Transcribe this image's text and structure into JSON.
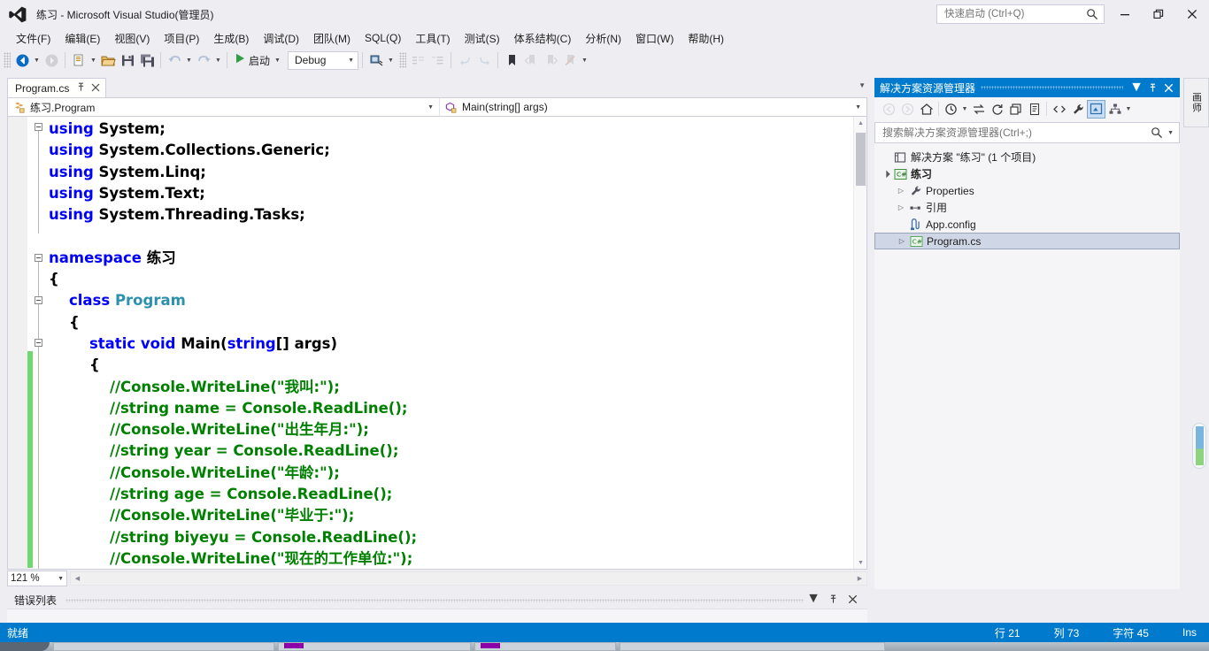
{
  "titlebar": {
    "app_title": "练习 - Microsoft Visual Studio(管理员)",
    "logo_icon": "visual-studio-logo-icon",
    "quick_launch_placeholder": "快速启动 (Ctrl+Q)",
    "quick_launch_value": "",
    "search_icon": "search-icon",
    "minimize_icon": "minimize-icon",
    "restore_icon": "restore-icon",
    "close_icon": "close-icon"
  },
  "menubar": {
    "items": [
      {
        "label": "文件(F)"
      },
      {
        "label": "编辑(E)"
      },
      {
        "label": "视图(V)"
      },
      {
        "label": "项目(P)"
      },
      {
        "label": "生成(B)"
      },
      {
        "label": "调试(D)"
      },
      {
        "label": "团队(M)"
      },
      {
        "label": "SQL(Q)"
      },
      {
        "label": "工具(T)"
      },
      {
        "label": "测试(S)"
      },
      {
        "label": "体系结构(C)"
      },
      {
        "label": "分析(N)"
      },
      {
        "label": "窗口(W)"
      },
      {
        "label": "帮助(H)"
      }
    ]
  },
  "toolbar": {
    "navigate_back_icon": "navigate-back-icon",
    "navigate_forward_icon": "navigate-forward-icon",
    "new_project_icon": "new-project-icon",
    "open_file_icon": "open-file-icon",
    "save_icon": "save-icon",
    "save_all_icon": "save-all-icon",
    "undo_icon": "undo-icon",
    "redo_icon": "redo-icon",
    "start_icon": "start-debug-play-icon",
    "start_label": "启动",
    "config_value": "Debug",
    "config_caret_icon": "chevron-down-icon",
    "attach_process_icon": "attach-to-process-icon",
    "comment_icon": "comment-selection-icon",
    "uncomment_icon": "uncomment-selection-icon",
    "undo_nav_icon": "undo-last-nav-icon",
    "redo_nav_icon": "redo-last-nav-icon",
    "bookmark_icon": "bookmark-icon",
    "prev_bookmark_icon": "previous-bookmark-icon",
    "next_bookmark_icon": "next-bookmark-icon",
    "clear_bookmark_icon": "clear-bookmark-icon",
    "overflow_icon": "toolbar-overflow-icon"
  },
  "editor": {
    "tab_label": "Program.cs",
    "tab_pin_icon": "pin-icon",
    "tab_close_icon": "close-icon",
    "nav_left_icon": "class-member-icon",
    "nav_left_value": "练习.Program",
    "nav_right_icon": "method-icon",
    "nav_right_value": "Main(string[] args)",
    "caret_icon": "chevron-down-icon",
    "zoom_level": "121 %",
    "code_lines": [
      {
        "indent": 0,
        "segments": [
          {
            "t": "using",
            "c": "k"
          },
          {
            "t": " System;",
            "c": ""
          }
        ]
      },
      {
        "indent": 0,
        "segments": [
          {
            "t": "using",
            "c": "k"
          },
          {
            "t": " System.Collections.Generic;",
            "c": ""
          }
        ]
      },
      {
        "indent": 0,
        "segments": [
          {
            "t": "using",
            "c": "k"
          },
          {
            "t": " System.Linq;",
            "c": ""
          }
        ]
      },
      {
        "indent": 0,
        "segments": [
          {
            "t": "using",
            "c": "k"
          },
          {
            "t": " System.Text;",
            "c": ""
          }
        ]
      },
      {
        "indent": 0,
        "segments": [
          {
            "t": "using",
            "c": "k"
          },
          {
            "t": " System.Threading.Tasks;",
            "c": ""
          }
        ]
      },
      {
        "indent": 0,
        "segments": [
          {
            "t": "",
            "c": ""
          }
        ]
      },
      {
        "indent": 0,
        "segments": [
          {
            "t": "namespace",
            "c": "k"
          },
          {
            "t": " 练习",
            "c": ""
          }
        ]
      },
      {
        "indent": 0,
        "segments": [
          {
            "t": "{",
            "c": ""
          }
        ]
      },
      {
        "indent": 1,
        "segments": [
          {
            "t": "class ",
            "c": "k"
          },
          {
            "t": "Program",
            "c": "ty"
          }
        ]
      },
      {
        "indent": 1,
        "segments": [
          {
            "t": "{",
            "c": ""
          }
        ]
      },
      {
        "indent": 2,
        "segments": [
          {
            "t": "static void ",
            "c": "k"
          },
          {
            "t": "Main(",
            "c": ""
          },
          {
            "t": "string",
            "c": "k"
          },
          {
            "t": "[] args)",
            "c": ""
          }
        ]
      },
      {
        "indent": 2,
        "segments": [
          {
            "t": "{",
            "c": ""
          }
        ]
      },
      {
        "indent": 3,
        "segments": [
          {
            "t": "//Console.WriteLine(\"我叫:\");",
            "c": "cm"
          }
        ]
      },
      {
        "indent": 3,
        "segments": [
          {
            "t": "//string name = Console.ReadLine();",
            "c": "cm"
          }
        ]
      },
      {
        "indent": 3,
        "segments": [
          {
            "t": "//Console.WriteLine(\"出生年月:\");",
            "c": "cm"
          }
        ]
      },
      {
        "indent": 3,
        "segments": [
          {
            "t": "//string year = Console.ReadLine();",
            "c": "cm"
          }
        ]
      },
      {
        "indent": 3,
        "segments": [
          {
            "t": "//Console.WriteLine(\"年龄:\");",
            "c": "cm"
          }
        ]
      },
      {
        "indent": 3,
        "segments": [
          {
            "t": "//string age = Console.ReadLine();",
            "c": "cm"
          }
        ]
      },
      {
        "indent": 3,
        "segments": [
          {
            "t": "//Console.WriteLine(\"毕业于:\");",
            "c": "cm"
          }
        ]
      },
      {
        "indent": 3,
        "segments": [
          {
            "t": "//string biyeyu = Console.ReadLine();",
            "c": "cm"
          }
        ]
      },
      {
        "indent": 3,
        "segments": [
          {
            "t": "//Console.WriteLine(\"现在的工作单位:\");",
            "c": "cm"
          }
        ]
      }
    ]
  },
  "error_panel": {
    "title": "错误列表",
    "dropdown_icon": "chevron-down-icon",
    "pin_icon": "pin-icon",
    "close_icon": "close-icon"
  },
  "solution_explorer": {
    "title": "解决方案资源管理器",
    "dropdown_icon": "chevron-down-icon",
    "pin_icon": "pin-icon",
    "close_icon": "close-icon",
    "toolbar": {
      "back_icon": "navigate-back-icon",
      "forward_icon": "navigate-forward-icon",
      "home_icon": "home-icon",
      "pending_changes_icon": "pending-changes-filter-icon",
      "sync_icon": "sync-with-active-document-icon",
      "refresh_icon": "refresh-icon",
      "collapse_all_icon": "collapse-all-icon",
      "show_all_files_icon": "show-all-files-icon",
      "code_view_icon": "view-code-icon",
      "properties_icon": "properties-wrench-icon",
      "preview_icon": "preview-selected-items-icon",
      "class_view_icon": "class-view-icon",
      "overflow_icon": "chevron-down-icon"
    },
    "search_placeholder": "搜索解决方案资源管理器(Ctrl+;)",
    "search_value": "",
    "search_icon": "search-icon",
    "search_caret_icon": "chevron-down-icon",
    "tree": [
      {
        "depth": 0,
        "arrow": "none",
        "icon": "solution-icon",
        "label": "解决方案 \"练习\" (1 个项目)",
        "bold": false,
        "selected": false
      },
      {
        "depth": 0,
        "arrow": "expanded",
        "icon": "csharp-project-icon",
        "label": "练习",
        "bold": true,
        "selected": false
      },
      {
        "depth": 1,
        "arrow": "collapsed",
        "icon": "properties-wrench-icon",
        "label": "Properties",
        "bold": false,
        "selected": false
      },
      {
        "depth": 1,
        "arrow": "collapsed",
        "icon": "references-icon",
        "label": "引用",
        "bold": false,
        "selected": false
      },
      {
        "depth": 1,
        "arrow": "none",
        "icon": "config-file-icon",
        "label": "App.config",
        "bold": false,
        "selected": false
      },
      {
        "depth": 1,
        "arrow": "collapsed",
        "icon": "csharp-file-icon",
        "label": "Program.cs",
        "bold": false,
        "selected": true
      }
    ]
  },
  "right_dock_tab": {
    "label": "画师"
  },
  "statusbar": {
    "ready": "就绪",
    "line": "行 21",
    "column": "列 73",
    "character": "字符 45",
    "insert_mode": "Ins"
  }
}
